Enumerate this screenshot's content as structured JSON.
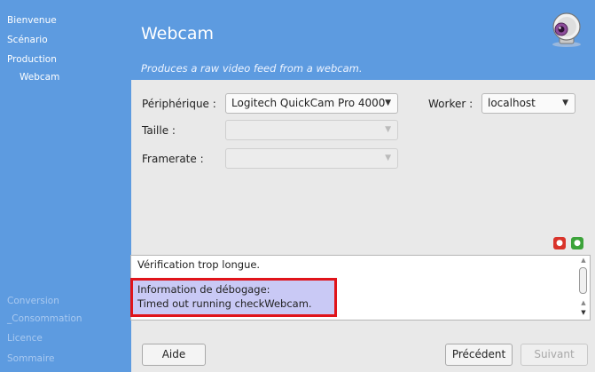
{
  "sidebar": {
    "items": [
      {
        "label": "Bienvenue",
        "state": "normal"
      },
      {
        "label": "Scénario",
        "state": "normal"
      },
      {
        "label": "Production",
        "state": "normal"
      },
      {
        "label": "Webcam",
        "state": "active"
      },
      {
        "label": "Conversion",
        "state": "dim"
      },
      {
        "label": "_Consommation",
        "state": "dim"
      },
      {
        "label": "Licence",
        "state": "dim"
      },
      {
        "label": "Sommaire",
        "state": "dim"
      }
    ]
  },
  "header": {
    "title": "Webcam",
    "subtitle": "Produces a raw video feed from a webcam.",
    "logo_icon": "webcam-icon"
  },
  "form": {
    "device_label": "Périphérique :",
    "device_value": "Logitech QuickCam Pro 4000",
    "worker_label": "Worker :",
    "worker_value": "localhost",
    "size_label": "Taille :",
    "size_value": "",
    "framerate_label": "Framerate :",
    "framerate_value": ""
  },
  "debug": {
    "line1": "Vérification trop longue.",
    "line2": "Information de débogage:",
    "line3": "Timed out running checkWebcam.",
    "icons": [
      "stop-icon",
      "go-icon"
    ]
  },
  "buttons": {
    "help": "Aide",
    "previous": "Précédent",
    "next": "Suivant"
  },
  "colors": {
    "sidebar_bg": "#5d9be0",
    "highlight_border": "#e0141b",
    "highlight_bg": "#c9c9f5"
  }
}
